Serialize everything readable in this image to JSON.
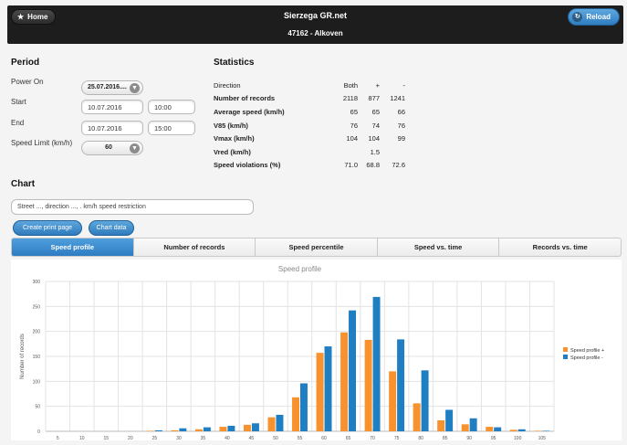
{
  "header": {
    "home_label": "Home",
    "title": "Sierzega GR.net",
    "subtitle": "47162 - Alkoven",
    "reload_label": "Reload"
  },
  "period": {
    "heading": "Period",
    "power_on_label": "Power On",
    "power_on_value": "25.07.2016....",
    "start_label": "Start",
    "start_date": "10.07.2016",
    "start_time": "10:00",
    "end_label": "End",
    "end_date": "10.07.2016",
    "end_time": "15:00",
    "speed_limit_label": "Speed Limit (km/h)",
    "speed_limit_value": "60"
  },
  "statistics": {
    "heading": "Statistics",
    "columns": [
      "Direction",
      "Both",
      "+",
      "-"
    ],
    "rows": [
      {
        "label": "Number of records",
        "both": "2118",
        "plus": "877",
        "minus": "1241"
      },
      {
        "label": "Average speed (km/h)",
        "both": "65",
        "plus": "65",
        "minus": "66"
      },
      {
        "label": "V85 (km/h)",
        "both": "76",
        "plus": "74",
        "minus": "76"
      },
      {
        "label": "Vmax (km/h)",
        "both": "104",
        "plus": "104",
        "minus": "99"
      },
      {
        "label": "Vred (km/h)",
        "both": "",
        "plus": "1.5",
        "minus": ""
      },
      {
        "label": "Speed violations (%)",
        "both": "71.0",
        "plus": "68.8",
        "minus": "72.6"
      }
    ]
  },
  "chart_section": {
    "heading": "Chart",
    "street_value": "Street ..., direction ..., . km/h speed restriction",
    "create_print_label": "Create print page",
    "chart_data_label": "Chart data",
    "tabs": [
      "Speed profile",
      "Number of records",
      "Speed percentile",
      "Speed vs. time",
      "Records vs. time"
    ]
  },
  "colors": {
    "plus": "#f7922e",
    "minus": "#1f7fc2",
    "accent": "#2f7dbf",
    "header_bg": "#1d1d1d"
  },
  "chart_data": {
    "type": "bar",
    "title": "Speed profile",
    "xlabel": "",
    "ylabel": "Number of records",
    "ylim": [
      0,
      300
    ],
    "yticks": [
      0,
      50,
      100,
      150,
      200,
      250,
      300
    ],
    "categories": [
      "5",
      "10",
      "15",
      "20",
      "25",
      "30",
      "35",
      "40",
      "45",
      "50",
      "55",
      "60",
      "65",
      "70",
      "75",
      "80",
      "85",
      "90",
      "95",
      "100",
      "105"
    ],
    "series": [
      {
        "name": "Speed profile +",
        "color": "#f7922e",
        "values": [
          0,
          0,
          0,
          0,
          1,
          2,
          4,
          9,
          13,
          28,
          68,
          157,
          198,
          183,
          120,
          56,
          22,
          14,
          9,
          3,
          1
        ]
      },
      {
        "name": "Speed profile -",
        "color": "#1f7fc2",
        "values": [
          0,
          0,
          0,
          0,
          2,
          6,
          8,
          11,
          16,
          33,
          96,
          170,
          242,
          269,
          184,
          122,
          43,
          26,
          8,
          4,
          1
        ]
      }
    ],
    "grid": true,
    "legend_position": "right"
  }
}
